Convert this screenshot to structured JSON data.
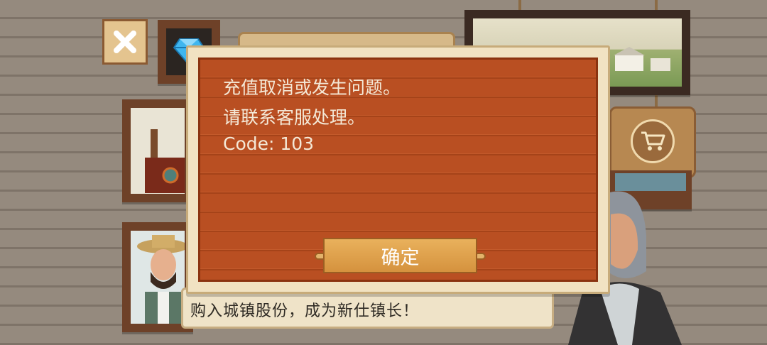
{
  "dialog": {
    "lines": [
      "充值取消或发生问题。",
      "请联系客服处理。",
      "Code: 103"
    ],
    "confirm_label": "确定"
  },
  "news": {
    "text": "购入城镇股份，成为新仕镇长！"
  },
  "icons": {
    "close": "close-x-icon",
    "gem": "diamond-icon",
    "cart": "shopping-cart-icon"
  },
  "colors": {
    "dialog_wood": "#b94f22",
    "confirm_button": "#e0a24c",
    "dialog_text": "#f4e8d6"
  }
}
